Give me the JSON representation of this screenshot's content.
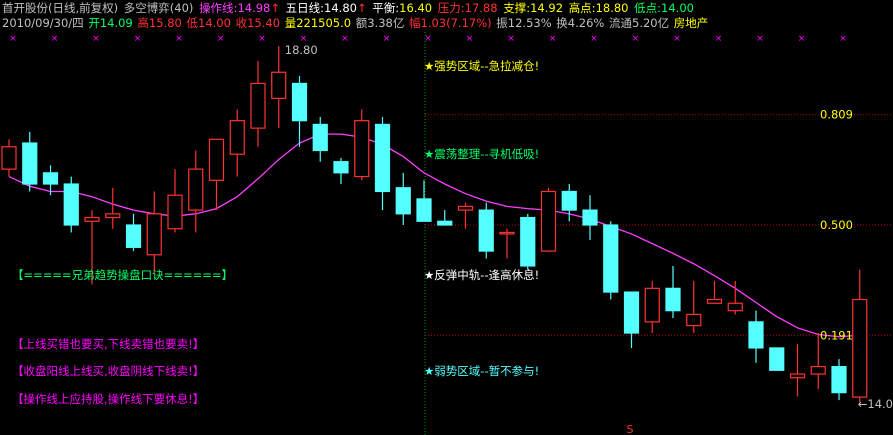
{
  "header": {
    "name": "首开股份",
    "period": "(日线,前复权)",
    "indicator": "多空博弈(40)",
    "op_label": "操作线:",
    "op_value": "14.98",
    "five_label": "五日线:",
    "five_value": "14.80",
    "balance_label": "平衡:",
    "balance_value": "16.40",
    "resist_label": "压力:",
    "resist_value": "17.88",
    "support_label": "支撑:",
    "support_value": "14.92",
    "high_label": "高点:",
    "high_value": "18.80",
    "low_label": "低点:",
    "low_value": "14.00",
    "arrow": "↑"
  },
  "quote": {
    "date": "2010/09/30/四",
    "open": "开14.09",
    "high": "高15.80",
    "low": "低14.00",
    "close": "收15.40",
    "volume": "量221505.0",
    "amount": "额3.38亿",
    "change": "幅1.03(7.17%)",
    "amplitude": "振12.53%",
    "turnover": "换4.26%",
    "float": "流通5.20亿",
    "sector": "房地产"
  },
  "zones": {
    "strong": "★强势区域--急拉减仓!",
    "range": "★震荡整理--寻机低吸!",
    "rebound": "★反弹中轨--逢高休息!",
    "weak": "★弱势区域--暂不参与!"
  },
  "tips": {
    "title": "【=====兄弟趋势操盘口诀======】",
    "tip1": "【上线买错也要买,下线卖错也要卖!】",
    "tip2": "【收盘阳线上线买,收盘阴线下线卖!】",
    "tip3": "【操作线上应持股,操作线下要休息!】"
  },
  "colors": {
    "up": "#ff3232",
    "down": "#54ffff",
    "ma": "#ff40ff",
    "grid": "#b00000",
    "divider": "#00a000",
    "yellow": "#ffff00",
    "green": "#00ff66",
    "white": "#ffffff",
    "cyan": "#54ffff",
    "magenta": "#ff00ff",
    "gray": "#c0c0c0"
  },
  "chart_data": {
    "type": "candlestick",
    "price_range": [
      13.85,
      18.95
    ],
    "levels": [
      {
        "label": "0.809",
        "price": 17.88
      },
      {
        "label": "0.500",
        "price": 16.4
      },
      {
        "label": "0.191",
        "price": 14.92
      }
    ],
    "high_label": "18.80",
    "low_label": "←14.00",
    "signal_label": "S",
    "candles": [
      {
        "o": 17.15,
        "c": 17.45,
        "h": 17.55,
        "l": 17.05
      },
      {
        "o": 17.5,
        "c": 16.95,
        "h": 17.65,
        "l": 16.85
      },
      {
        "o": 17.1,
        "c": 16.95,
        "h": 17.2,
        "l": 16.8
      },
      {
        "o": 16.95,
        "c": 16.4,
        "h": 17.05,
        "l": 16.3
      },
      {
        "o": 16.45,
        "c": 16.5,
        "h": 16.6,
        "l": 15.6
      },
      {
        "o": 16.5,
        "c": 16.55,
        "h": 16.9,
        "l": 16.35
      },
      {
        "o": 16.4,
        "c": 16.1,
        "h": 16.55,
        "l": 16.05
      },
      {
        "o": 16.0,
        "c": 16.55,
        "h": 16.85,
        "l": 15.75
      },
      {
        "o": 16.35,
        "c": 16.8,
        "h": 17.15,
        "l": 16.3
      },
      {
        "o": 16.6,
        "c": 17.15,
        "h": 17.4,
        "l": 16.3
      },
      {
        "o": 17.0,
        "c": 17.55,
        "h": 17.55,
        "l": 16.6
      },
      {
        "o": 17.35,
        "c": 17.8,
        "h": 17.95,
        "l": 17.05
      },
      {
        "o": 17.7,
        "c": 18.3,
        "h": 18.6,
        "l": 17.45
      },
      {
        "o": 18.1,
        "c": 18.45,
        "h": 18.8,
        "l": 17.7
      },
      {
        "o": 18.3,
        "c": 17.8,
        "h": 18.4,
        "l": 17.45
      },
      {
        "o": 17.75,
        "c": 17.4,
        "h": 17.85,
        "l": 17.25
      },
      {
        "o": 17.25,
        "c": 17.1,
        "h": 17.3,
        "l": 16.95
      },
      {
        "o": 17.05,
        "c": 17.8,
        "h": 17.95,
        "l": 17.0
      },
      {
        "o": 17.75,
        "c": 16.85,
        "h": 17.85,
        "l": 16.6
      },
      {
        "o": 16.9,
        "c": 16.55,
        "h": 17.1,
        "l": 16.4
      },
      {
        "o": 16.75,
        "c": 16.45,
        "h": 17.0,
        "l": 16.45
      },
      {
        "o": 16.45,
        "c": 16.4,
        "h": 16.6,
        "l": 16.4
      },
      {
        "o": 16.6,
        "c": 16.65,
        "h": 16.7,
        "l": 16.35
      },
      {
        "o": 16.6,
        "c": 16.05,
        "h": 16.7,
        "l": 15.95
      },
      {
        "o": 16.3,
        "c": 16.3,
        "h": 16.35,
        "l": 15.95
      },
      {
        "o": 16.5,
        "c": 15.85,
        "h": 16.55,
        "l": 15.8
      },
      {
        "o": 16.05,
        "c": 16.85,
        "h": 16.9,
        "l": 16.05
      },
      {
        "o": 16.85,
        "c": 16.6,
        "h": 16.95,
        "l": 16.45
      },
      {
        "o": 16.6,
        "c": 16.4,
        "h": 16.8,
        "l": 16.2
      },
      {
        "o": 16.4,
        "c": 15.5,
        "h": 16.45,
        "l": 15.4
      },
      {
        "o": 15.5,
        "c": 14.95,
        "h": 15.5,
        "l": 14.75
      },
      {
        "o": 15.1,
        "c": 15.55,
        "h": 15.65,
        "l": 14.95
      },
      {
        "o": 15.55,
        "c": 15.25,
        "h": 15.85,
        "l": 15.15
      },
      {
        "o": 15.05,
        "c": 15.2,
        "h": 15.65,
        "l": 14.95
      },
      {
        "o": 15.35,
        "c": 15.4,
        "h": 15.65,
        "l": 15.35
      },
      {
        "o": 15.25,
        "c": 15.35,
        "h": 15.65,
        "l": 15.2
      },
      {
        "o": 15.1,
        "c": 14.75,
        "h": 15.25,
        "l": 14.55
      },
      {
        "o": 14.75,
        "c": 14.45,
        "h": 14.75,
        "l": 14.45
      },
      {
        "o": 14.35,
        "c": 14.4,
        "h": 14.8,
        "l": 14.1
      },
      {
        "o": 14.4,
        "c": 14.5,
        "h": 14.95,
        "l": 14.2
      },
      {
        "o": 14.5,
        "c": 14.15,
        "h": 14.6,
        "l": 14.05
      },
      {
        "o": 14.09,
        "c": 15.4,
        "h": 15.8,
        "l": 14.0
      }
    ],
    "ma": [
      17.05,
      16.92,
      16.85,
      16.85,
      16.78,
      16.68,
      16.6,
      16.55,
      16.52,
      16.55,
      16.62,
      16.78,
      17.02,
      17.28,
      17.5,
      17.62,
      17.62,
      17.58,
      17.48,
      17.32,
      17.1,
      16.95,
      16.82,
      16.72,
      16.65,
      16.62,
      16.6,
      16.55,
      16.48,
      16.38,
      16.28,
      16.15,
      16.02,
      15.88,
      15.72,
      15.55,
      15.36,
      15.17,
      15.02,
      14.93,
      14.9,
      14.92
    ]
  }
}
